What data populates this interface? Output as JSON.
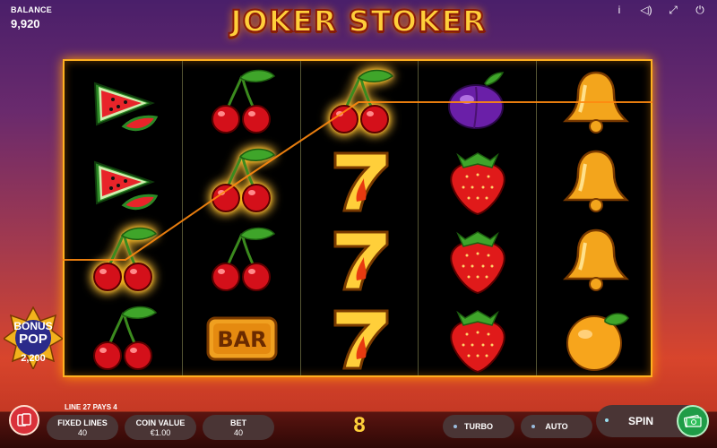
{
  "header": {
    "balance_label": "BALANCE",
    "balance_value": "9,920",
    "logo_text": "JOKER STOKER"
  },
  "top_icons": [
    "info-icon",
    "sound-icon",
    "fullscreen-icon",
    "power-icon"
  ],
  "reels": [
    [
      "watermelon",
      "watermelon",
      "cherry",
      "cherry"
    ],
    [
      "cherry",
      "cherry",
      "cherry",
      "bar"
    ],
    [
      "cherry",
      "seven",
      "seven",
      "seven"
    ],
    [
      "plum",
      "strawberry",
      "strawberry",
      "strawberry"
    ],
    [
      "bell",
      "bell",
      "bell",
      "orange"
    ]
  ],
  "bar_symbol_text": "BAR",
  "bonus_pop": {
    "line1": "BONUS",
    "line2": "POP",
    "amount": "2,200"
  },
  "win_info": "LINE 27 PAYS 4",
  "controls": {
    "fixed_lines": {
      "label": "FIXED LINES",
      "value": "40"
    },
    "coin_value": {
      "label": "COIN VALUE",
      "value": "€1.00"
    },
    "bet": {
      "label": "BET",
      "value": "40"
    },
    "lines_count": "8",
    "turbo": "TURBO",
    "auto": "AUTO",
    "spin": "SPIN"
  },
  "colors": {
    "accent": "#ffb020",
    "spin_button": "#1f9c47",
    "menu_button": "#d9313a"
  }
}
